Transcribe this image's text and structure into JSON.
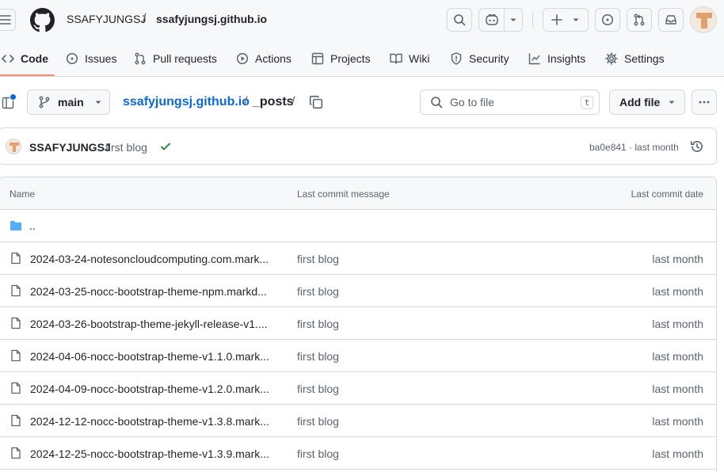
{
  "header": {
    "owner": "SSAFYJUNGSJ",
    "separator": "/",
    "repo": "ssafyjungsj.github.io"
  },
  "nav": {
    "tabs": [
      {
        "label": "Code",
        "icon": "code-icon"
      },
      {
        "label": "Issues",
        "icon": "issue-opened-icon"
      },
      {
        "label": "Pull requests",
        "icon": "git-pull-request-icon"
      },
      {
        "label": "Actions",
        "icon": "play-icon"
      },
      {
        "label": "Projects",
        "icon": "table-icon"
      },
      {
        "label": "Wiki",
        "icon": "book-icon"
      },
      {
        "label": "Security",
        "icon": "shield-icon"
      },
      {
        "label": "Insights",
        "icon": "graph-icon"
      },
      {
        "label": "Settings",
        "icon": "gear-icon"
      }
    ],
    "active": "Code"
  },
  "breadcrumb": {
    "branch": "main",
    "repo": "ssafyjungsj.github.io",
    "sep": "/",
    "dir": "_posts"
  },
  "search": {
    "placeholder": "Go to file",
    "shortcut": "t"
  },
  "actions": {
    "add_file": "Add file"
  },
  "latest_commit": {
    "author": "SSAFYJUNGSJ",
    "message": "first blog",
    "hash_and_time": "ba0e841 · last month"
  },
  "table": {
    "headers": {
      "name": "Name",
      "message": "Last commit message",
      "date": "Last commit date"
    },
    "parent_dir": "..",
    "rows": [
      {
        "name": "2024-03-24-notesoncloudcomputing.com.mark...",
        "message": "first blog",
        "date": "last month"
      },
      {
        "name": "2024-03-25-nocc-bootstrap-theme-npm.markd...",
        "message": "first blog",
        "date": "last month"
      },
      {
        "name": "2024-03-26-bootstrap-theme-jekyll-release-v1....",
        "message": "first blog",
        "date": "last month"
      },
      {
        "name": "2024-04-06-nocc-bootstrap-theme-v1.1.0.mark...",
        "message": "first blog",
        "date": "last month"
      },
      {
        "name": "2024-04-09-nocc-bootstrap-theme-v1.2.0.mark...",
        "message": "first blog",
        "date": "last month"
      },
      {
        "name": "2024-12-12-nocc-bootstrap-theme-v1.3.8.mark...",
        "message": "first blog",
        "date": "last month"
      },
      {
        "name": "2024-12-25-nocc-bootstrap-theme-v1.3.9.mark...",
        "message": "first blog",
        "date": "last month"
      }
    ]
  },
  "colors": {
    "accent_link": "#0969da",
    "active_tab_underline": "#fd8c73",
    "success_check": "#1a7f37",
    "folder_icon": "#54aeff"
  }
}
